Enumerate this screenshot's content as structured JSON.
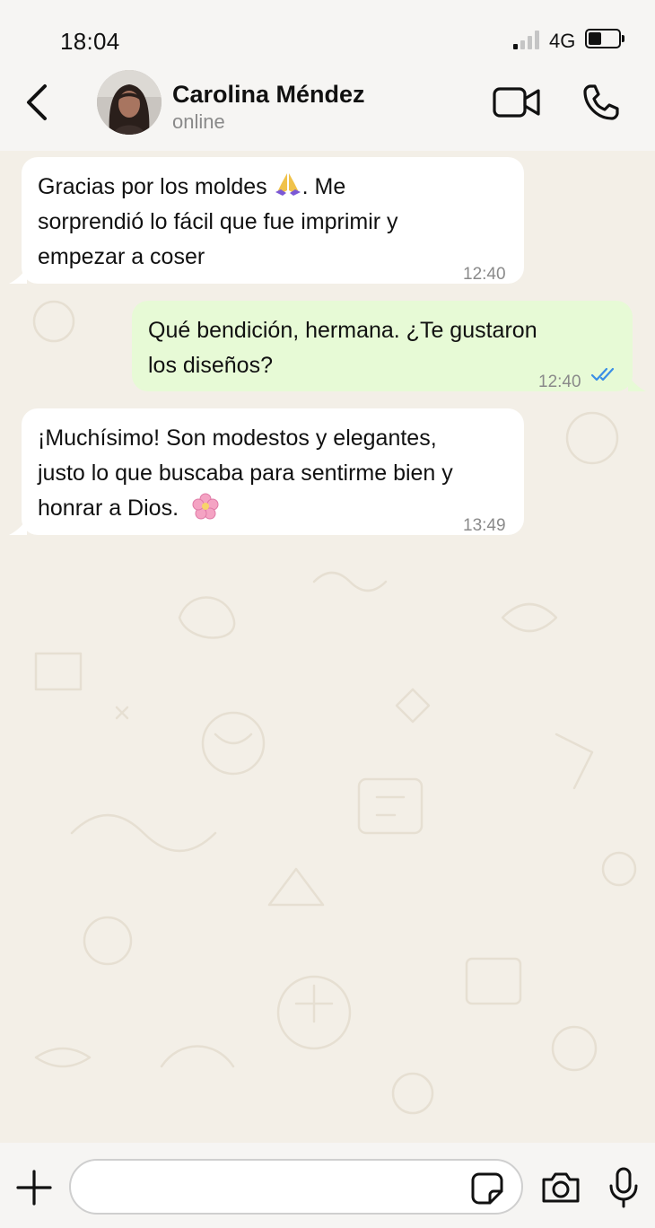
{
  "status_bar": {
    "time": "18:04",
    "network": "4G",
    "battery_level": 0.45
  },
  "header": {
    "contact_name": "Carolina Méndez",
    "contact_status": "online",
    "icons": [
      "back-arrow-icon",
      "video-call-icon",
      "phone-icon"
    ]
  },
  "messages": [
    {
      "direction": "incoming",
      "lines": [
        "Gracias por los moldes",
        ". Me",
        "sorprendió lo fácil que fue imprimir y",
        "empezar a coser"
      ],
      "emoji": "folded-hands",
      "time": "12:40"
    },
    {
      "direction": "outgoing",
      "lines": [
        "Qué bendición, hermana. ¿Te gustaron",
        "los diseños?"
      ],
      "time": "12:40",
      "read_receipt": "double-check-blue"
    },
    {
      "direction": "incoming",
      "lines": [
        "¡Muchísimo! Son modestos y elegantes,",
        "justo lo que buscaba para sentirme bien y",
        "honrar a Dios."
      ],
      "emoji": "cherry-blossom",
      "time": "13:49"
    }
  ],
  "input_bar": {
    "placeholder": "",
    "icons": [
      "plus-icon",
      "sticker-icon",
      "camera-icon",
      "microphone-icon"
    ]
  },
  "colors": {
    "incoming_bubble": "#ffffff",
    "outgoing_bubble": "#e7fad6",
    "chat_background": "#f3efe7",
    "read_receipt": "#3a8ee6",
    "timestamp": "#8a8a8a"
  }
}
